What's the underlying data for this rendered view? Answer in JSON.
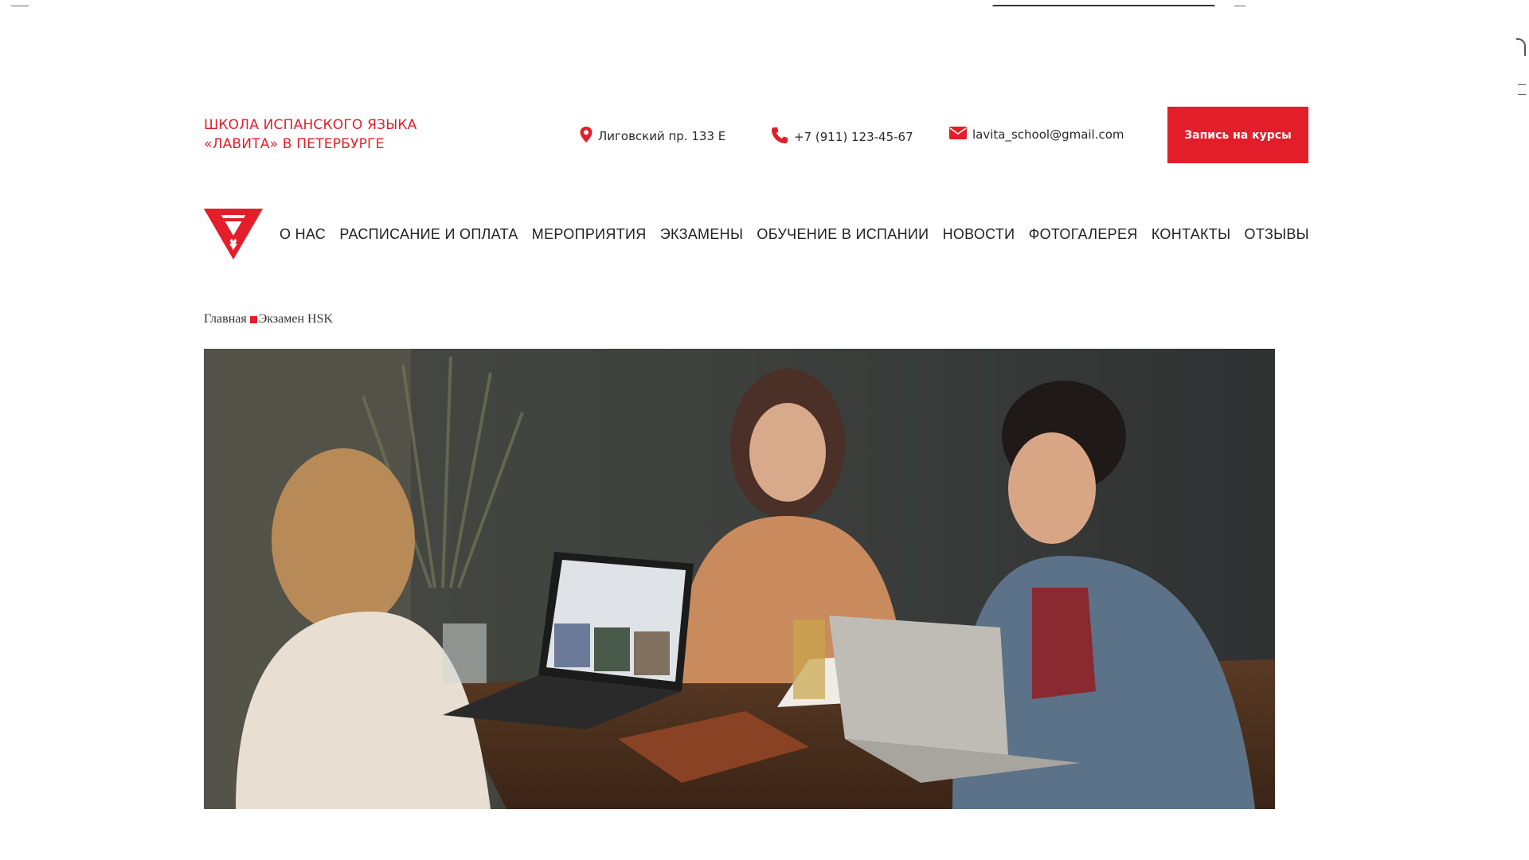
{
  "header": {
    "school_title_line1": "ШКОЛА ИСПАНСКОГО ЯЗЫКА",
    "school_title_line2": "«ЛАВИТА» В ПЕТЕРБУРГЕ",
    "address": "Лиговский пр. 133 Е",
    "phone": "+7 (911) 123-45-67",
    "email": "lavita_school@gmail.com",
    "cta_label": "Запись на курсы"
  },
  "nav": {
    "items": [
      "О НАС",
      "РАСПИСАНИЕ И ОПЛАТА",
      "МЕРОПРИЯТИЯ",
      "ЭКЗАМЕНЫ",
      "ОБУЧЕНИЕ В ИСПАНИИ",
      "НОВОСТИ",
      "ФОТОГАЛЕРЕЯ",
      "КОНТАКТЫ",
      "ОТЗЫВЫ"
    ]
  },
  "breadcrumb": {
    "home": "Главная",
    "current": "Экзамен HSK"
  },
  "icons": {
    "address": "map-pin-icon",
    "phone": "phone-icon",
    "email": "envelope-icon",
    "logo": "triangle-logo"
  },
  "colors": {
    "brand_red": "#e31e2a",
    "text": "#2a2a2a"
  }
}
